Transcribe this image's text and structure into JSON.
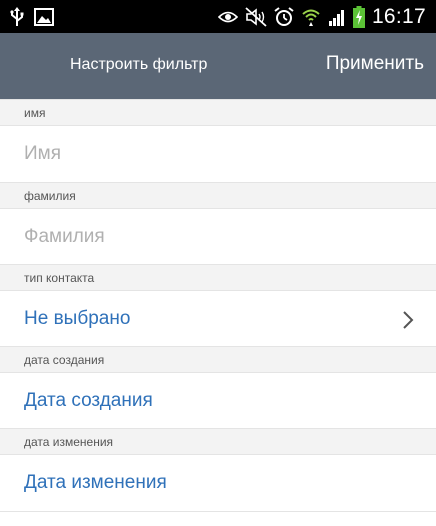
{
  "status_bar": {
    "time": "16:17",
    "icons": [
      "usb-icon",
      "picture-icon",
      "eye-icon",
      "mute-icon",
      "alarm-icon",
      "wifi-icon",
      "signal-icon",
      "battery-charging-icon"
    ]
  },
  "action_bar": {
    "title": "Настроить фильтр",
    "apply_label": "Применить"
  },
  "sections": {
    "first_name": {
      "header": "имя",
      "placeholder": "Имя"
    },
    "last_name": {
      "header": "фамилия",
      "placeholder": "Фамилия"
    },
    "contact_type": {
      "header": "тип контакта",
      "value": "Не выбрано"
    },
    "created_date": {
      "header": "дата создания",
      "value": "Дата создания"
    },
    "modified_date": {
      "header": "дата изменения",
      "value": "Дата изменения"
    }
  },
  "colors": {
    "action_bar": "#5b6776",
    "link": "#2f71b9",
    "section_header_bg": "#f3f3f3"
  }
}
